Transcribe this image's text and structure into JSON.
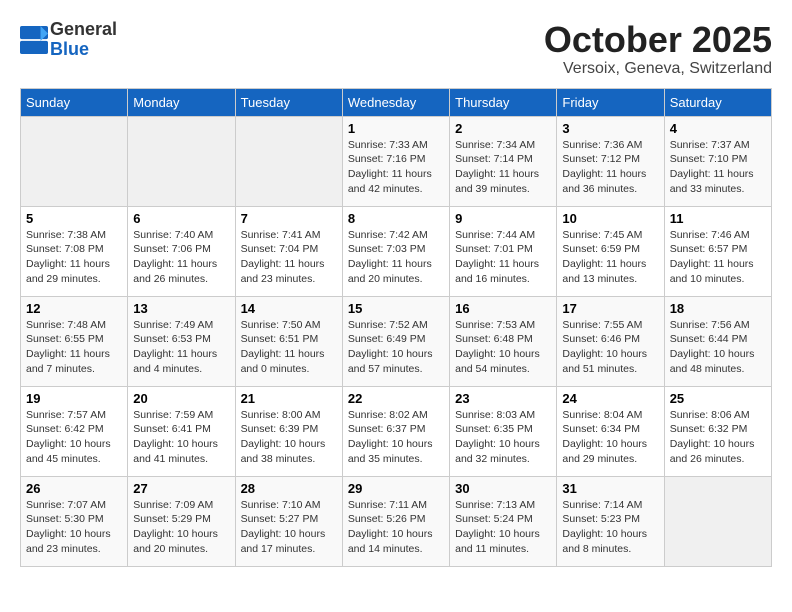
{
  "logo": {
    "general": "General",
    "blue": "Blue"
  },
  "header": {
    "month": "October 2025",
    "location": "Versoix, Geneva, Switzerland"
  },
  "weekdays": [
    "Sunday",
    "Monday",
    "Tuesday",
    "Wednesday",
    "Thursday",
    "Friday",
    "Saturday"
  ],
  "weeks": [
    [
      {
        "day": "",
        "sunrise": "",
        "sunset": "",
        "daylight": "",
        "empty": true
      },
      {
        "day": "",
        "sunrise": "",
        "sunset": "",
        "daylight": "",
        "empty": true
      },
      {
        "day": "",
        "sunrise": "",
        "sunset": "",
        "daylight": "",
        "empty": true
      },
      {
        "day": "1",
        "sunrise": "Sunrise: 7:33 AM",
        "sunset": "Sunset: 7:16 PM",
        "daylight": "Daylight: 11 hours and 42 minutes."
      },
      {
        "day": "2",
        "sunrise": "Sunrise: 7:34 AM",
        "sunset": "Sunset: 7:14 PM",
        "daylight": "Daylight: 11 hours and 39 minutes."
      },
      {
        "day": "3",
        "sunrise": "Sunrise: 7:36 AM",
        "sunset": "Sunset: 7:12 PM",
        "daylight": "Daylight: 11 hours and 36 minutes."
      },
      {
        "day": "4",
        "sunrise": "Sunrise: 7:37 AM",
        "sunset": "Sunset: 7:10 PM",
        "daylight": "Daylight: 11 hours and 33 minutes."
      }
    ],
    [
      {
        "day": "5",
        "sunrise": "Sunrise: 7:38 AM",
        "sunset": "Sunset: 7:08 PM",
        "daylight": "Daylight: 11 hours and 29 minutes."
      },
      {
        "day": "6",
        "sunrise": "Sunrise: 7:40 AM",
        "sunset": "Sunset: 7:06 PM",
        "daylight": "Daylight: 11 hours and 26 minutes."
      },
      {
        "day": "7",
        "sunrise": "Sunrise: 7:41 AM",
        "sunset": "Sunset: 7:04 PM",
        "daylight": "Daylight: 11 hours and 23 minutes."
      },
      {
        "day": "8",
        "sunrise": "Sunrise: 7:42 AM",
        "sunset": "Sunset: 7:03 PM",
        "daylight": "Daylight: 11 hours and 20 minutes."
      },
      {
        "day": "9",
        "sunrise": "Sunrise: 7:44 AM",
        "sunset": "Sunset: 7:01 PM",
        "daylight": "Daylight: 11 hours and 16 minutes."
      },
      {
        "day": "10",
        "sunrise": "Sunrise: 7:45 AM",
        "sunset": "Sunset: 6:59 PM",
        "daylight": "Daylight: 11 hours and 13 minutes."
      },
      {
        "day": "11",
        "sunrise": "Sunrise: 7:46 AM",
        "sunset": "Sunset: 6:57 PM",
        "daylight": "Daylight: 11 hours and 10 minutes."
      }
    ],
    [
      {
        "day": "12",
        "sunrise": "Sunrise: 7:48 AM",
        "sunset": "Sunset: 6:55 PM",
        "daylight": "Daylight: 11 hours and 7 minutes."
      },
      {
        "day": "13",
        "sunrise": "Sunrise: 7:49 AM",
        "sunset": "Sunset: 6:53 PM",
        "daylight": "Daylight: 11 hours and 4 minutes."
      },
      {
        "day": "14",
        "sunrise": "Sunrise: 7:50 AM",
        "sunset": "Sunset: 6:51 PM",
        "daylight": "Daylight: 11 hours and 0 minutes."
      },
      {
        "day": "15",
        "sunrise": "Sunrise: 7:52 AM",
        "sunset": "Sunset: 6:49 PM",
        "daylight": "Daylight: 10 hours and 57 minutes."
      },
      {
        "day": "16",
        "sunrise": "Sunrise: 7:53 AM",
        "sunset": "Sunset: 6:48 PM",
        "daylight": "Daylight: 10 hours and 54 minutes."
      },
      {
        "day": "17",
        "sunrise": "Sunrise: 7:55 AM",
        "sunset": "Sunset: 6:46 PM",
        "daylight": "Daylight: 10 hours and 51 minutes."
      },
      {
        "day": "18",
        "sunrise": "Sunrise: 7:56 AM",
        "sunset": "Sunset: 6:44 PM",
        "daylight": "Daylight: 10 hours and 48 minutes."
      }
    ],
    [
      {
        "day": "19",
        "sunrise": "Sunrise: 7:57 AM",
        "sunset": "Sunset: 6:42 PM",
        "daylight": "Daylight: 10 hours and 45 minutes."
      },
      {
        "day": "20",
        "sunrise": "Sunrise: 7:59 AM",
        "sunset": "Sunset: 6:41 PM",
        "daylight": "Daylight: 10 hours and 41 minutes."
      },
      {
        "day": "21",
        "sunrise": "Sunrise: 8:00 AM",
        "sunset": "Sunset: 6:39 PM",
        "daylight": "Daylight: 10 hours and 38 minutes."
      },
      {
        "day": "22",
        "sunrise": "Sunrise: 8:02 AM",
        "sunset": "Sunset: 6:37 PM",
        "daylight": "Daylight: 10 hours and 35 minutes."
      },
      {
        "day": "23",
        "sunrise": "Sunrise: 8:03 AM",
        "sunset": "Sunset: 6:35 PM",
        "daylight": "Daylight: 10 hours and 32 minutes."
      },
      {
        "day": "24",
        "sunrise": "Sunrise: 8:04 AM",
        "sunset": "Sunset: 6:34 PM",
        "daylight": "Daylight: 10 hours and 29 minutes."
      },
      {
        "day": "25",
        "sunrise": "Sunrise: 8:06 AM",
        "sunset": "Sunset: 6:32 PM",
        "daylight": "Daylight: 10 hours and 26 minutes."
      }
    ],
    [
      {
        "day": "26",
        "sunrise": "Sunrise: 7:07 AM",
        "sunset": "Sunset: 5:30 PM",
        "daylight": "Daylight: 10 hours and 23 minutes."
      },
      {
        "day": "27",
        "sunrise": "Sunrise: 7:09 AM",
        "sunset": "Sunset: 5:29 PM",
        "daylight": "Daylight: 10 hours and 20 minutes."
      },
      {
        "day": "28",
        "sunrise": "Sunrise: 7:10 AM",
        "sunset": "Sunset: 5:27 PM",
        "daylight": "Daylight: 10 hours and 17 minutes."
      },
      {
        "day": "29",
        "sunrise": "Sunrise: 7:11 AM",
        "sunset": "Sunset: 5:26 PM",
        "daylight": "Daylight: 10 hours and 14 minutes."
      },
      {
        "day": "30",
        "sunrise": "Sunrise: 7:13 AM",
        "sunset": "Sunset: 5:24 PM",
        "daylight": "Daylight: 10 hours and 11 minutes."
      },
      {
        "day": "31",
        "sunrise": "Sunrise: 7:14 AM",
        "sunset": "Sunset: 5:23 PM",
        "daylight": "Daylight: 10 hours and 8 minutes."
      },
      {
        "day": "",
        "sunrise": "",
        "sunset": "",
        "daylight": "",
        "empty": true
      }
    ]
  ]
}
